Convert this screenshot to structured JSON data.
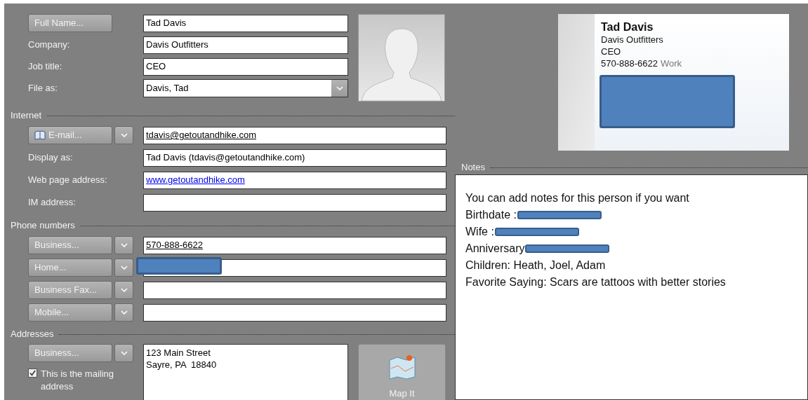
{
  "name_rows": [
    {
      "kind": "button",
      "label": "Full Name...",
      "value": "Tad Davis"
    },
    {
      "kind": "label",
      "label": "Company:",
      "value": "Davis Outfitters"
    },
    {
      "kind": "label",
      "label": "Job title:",
      "value": "CEO"
    },
    {
      "kind": "dropdown",
      "label": "File as:",
      "value": "Davis, Tad"
    }
  ],
  "sections": [
    {
      "title": "Internet",
      "rows": [
        {
          "kind": "split_button",
          "label": "E-mail...",
          "book_icon": true,
          "value": "tdavis@getoutandhike.com",
          "underlined": true,
          "link": false
        },
        {
          "kind": "label",
          "label": "Display as:",
          "value": "Tad Davis (tdavis@getoutandhike.com)",
          "underlined": false,
          "link": false
        },
        {
          "kind": "label",
          "label": "Web page address:",
          "value": "www.getoutandhike.com",
          "underlined": true,
          "link": true
        },
        {
          "kind": "label",
          "label": "IM address:"
        }
      ]
    },
    {
      "title": "Phone numbers",
      "rows": [
        {
          "kind": "split_button",
          "label": "Business...",
          "value": "570-888-6622",
          "underlined": true,
          "link": false
        },
        {
          "kind": "split_button",
          "label": "Home...",
          "redacted": true
        },
        {
          "kind": "split_button",
          "label": "Business Fax..."
        },
        {
          "kind": "split_button",
          "label": "Mobile..."
        }
      ]
    }
  ],
  "addresses": {
    "title": "Addresses",
    "type_button": "Business...",
    "lines": [
      "123 Main Street",
      "Sayre, PA  18840"
    ],
    "mailing": {
      "label": "This is the mailing address",
      "checked": true
    },
    "map_button": "Map It"
  },
  "card": {
    "name": "Tad Davis",
    "lines": [
      {
        "text": "Davis Outfitters"
      },
      {
        "text": "CEO"
      },
      {
        "text": "570-888-6622",
        "suffix": "Work"
      }
    ],
    "redacted": true
  },
  "notes": {
    "title": "Notes",
    "lines": [
      {
        "text": "You can add notes for this person if you want",
        "redacted": false
      },
      {
        "text": "Birthdate :",
        "redacted": true
      },
      {
        "text": "Wife :",
        "redacted": true
      },
      {
        "text": "Anniversary",
        "redacted": true
      },
      {
        "text": "Children: Heath, Joel, Adam",
        "redacted": false
      },
      {
        "text": "Favorite Saying: Scars are tattoos with better stories",
        "redacted": false
      }
    ]
  }
}
